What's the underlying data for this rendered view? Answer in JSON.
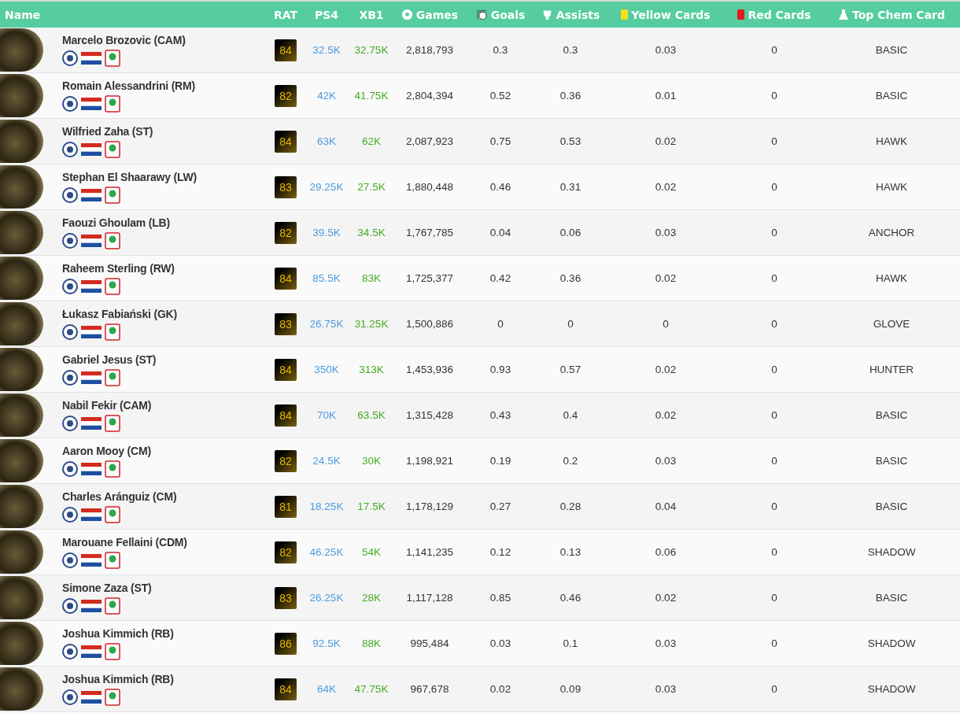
{
  "table": {
    "columns": [
      "Name",
      "RAT",
      "PS4",
      "XB1",
      "Games",
      "Goals",
      "Assists",
      "Yellow Cards",
      "Red Cards",
      "Top Chem Card"
    ],
    "rows": [
      {
        "name": "Marcelo Brozovic (CAM)",
        "rating": "84",
        "ps4": "32.5K",
        "xb1": "32.75K",
        "games": "2,818,793",
        "goals": "0.3",
        "assists": "0.3",
        "yellow": "0.03",
        "red": "0",
        "chem": "BASIC"
      },
      {
        "name": "Romain Alessandrini (RM)",
        "rating": "82",
        "ps4": "42K",
        "xb1": "41.75K",
        "games": "2,804,394",
        "goals": "0.52",
        "assists": "0.36",
        "yellow": "0.01",
        "red": "0",
        "chem": "BASIC"
      },
      {
        "name": "Wilfried Zaha (ST)",
        "rating": "84",
        "ps4": "63K",
        "xb1": "62K",
        "games": "2,087,923",
        "goals": "0.75",
        "assists": "0.53",
        "yellow": "0.02",
        "red": "0",
        "chem": "HAWK"
      },
      {
        "name": "Stephan El Shaarawy (LW)",
        "rating": "83",
        "ps4": "29.25K",
        "xb1": "27.5K",
        "games": "1,880,448",
        "goals": "0.46",
        "assists": "0.31",
        "yellow": "0.02",
        "red": "0",
        "chem": "HAWK"
      },
      {
        "name": "Faouzi Ghoulam (LB)",
        "rating": "82",
        "ps4": "39.5K",
        "xb1": "34.5K",
        "games": "1,767,785",
        "goals": "0.04",
        "assists": "0.06",
        "yellow": "0.03",
        "red": "0",
        "chem": "ANCHOR"
      },
      {
        "name": "Raheem Sterling (RW)",
        "rating": "84",
        "ps4": "85.5K",
        "xb1": "83K",
        "games": "1,725,377",
        "goals": "0.42",
        "assists": "0.36",
        "yellow": "0.02",
        "red": "0",
        "chem": "HAWK"
      },
      {
        "name": "Łukasz Fabiański (GK)",
        "rating": "83",
        "ps4": "26.75K",
        "xb1": "31.25K",
        "games": "1,500,886",
        "goals": "0",
        "assists": "0",
        "yellow": "0",
        "red": "0",
        "chem": "GLOVE"
      },
      {
        "name": "Gabriel Jesus (ST)",
        "rating": "84",
        "ps4": "350K",
        "xb1": "313K",
        "games": "1,453,936",
        "goals": "0.93",
        "assists": "0.57",
        "yellow": "0.02",
        "red": "0",
        "chem": "HUNTER"
      },
      {
        "name": "Nabil Fekir (CAM)",
        "rating": "84",
        "ps4": "70K",
        "xb1": "63.5K",
        "games": "1,315,428",
        "goals": "0.43",
        "assists": "0.4",
        "yellow": "0.02",
        "red": "0",
        "chem": "BASIC"
      },
      {
        "name": "Aaron Mooy (CM)",
        "rating": "82",
        "ps4": "24.5K",
        "xb1": "30K",
        "games": "1,198,921",
        "goals": "0.19",
        "assists": "0.2",
        "yellow": "0.03",
        "red": "0",
        "chem": "BASIC"
      },
      {
        "name": "Charles Aránguiz (CM)",
        "rating": "81",
        "ps4": "18.25K",
        "xb1": "17.5K",
        "games": "1,178,129",
        "goals": "0.27",
        "assists": "0.28",
        "yellow": "0.04",
        "red": "0",
        "chem": "BASIC"
      },
      {
        "name": "Marouane Fellaini (CDM)",
        "rating": "82",
        "ps4": "46.25K",
        "xb1": "54K",
        "games": "1,141,235",
        "goals": "0.12",
        "assists": "0.13",
        "yellow": "0.06",
        "red": "0",
        "chem": "SHADOW"
      },
      {
        "name": "Simone Zaza (ST)",
        "rating": "83",
        "ps4": "26.25K",
        "xb1": "28K",
        "games": "1,117,128",
        "goals": "0.85",
        "assists": "0.46",
        "yellow": "0.02",
        "red": "0",
        "chem": "BASIC"
      },
      {
        "name": "Joshua Kimmich (RB)",
        "rating": "86",
        "ps4": "92.5K",
        "xb1": "88K",
        "games": "995,484",
        "goals": "0.03",
        "assists": "0.1",
        "yellow": "0.03",
        "red": "0",
        "chem": "SHADOW"
      },
      {
        "name": "Joshua Kimmich (RB)",
        "rating": "84",
        "ps4": "64K",
        "xb1": "47.75K",
        "games": "967,678",
        "goals": "0.02",
        "assists": "0.09",
        "yellow": "0.03",
        "red": "0",
        "chem": "SHADOW"
      }
    ]
  }
}
